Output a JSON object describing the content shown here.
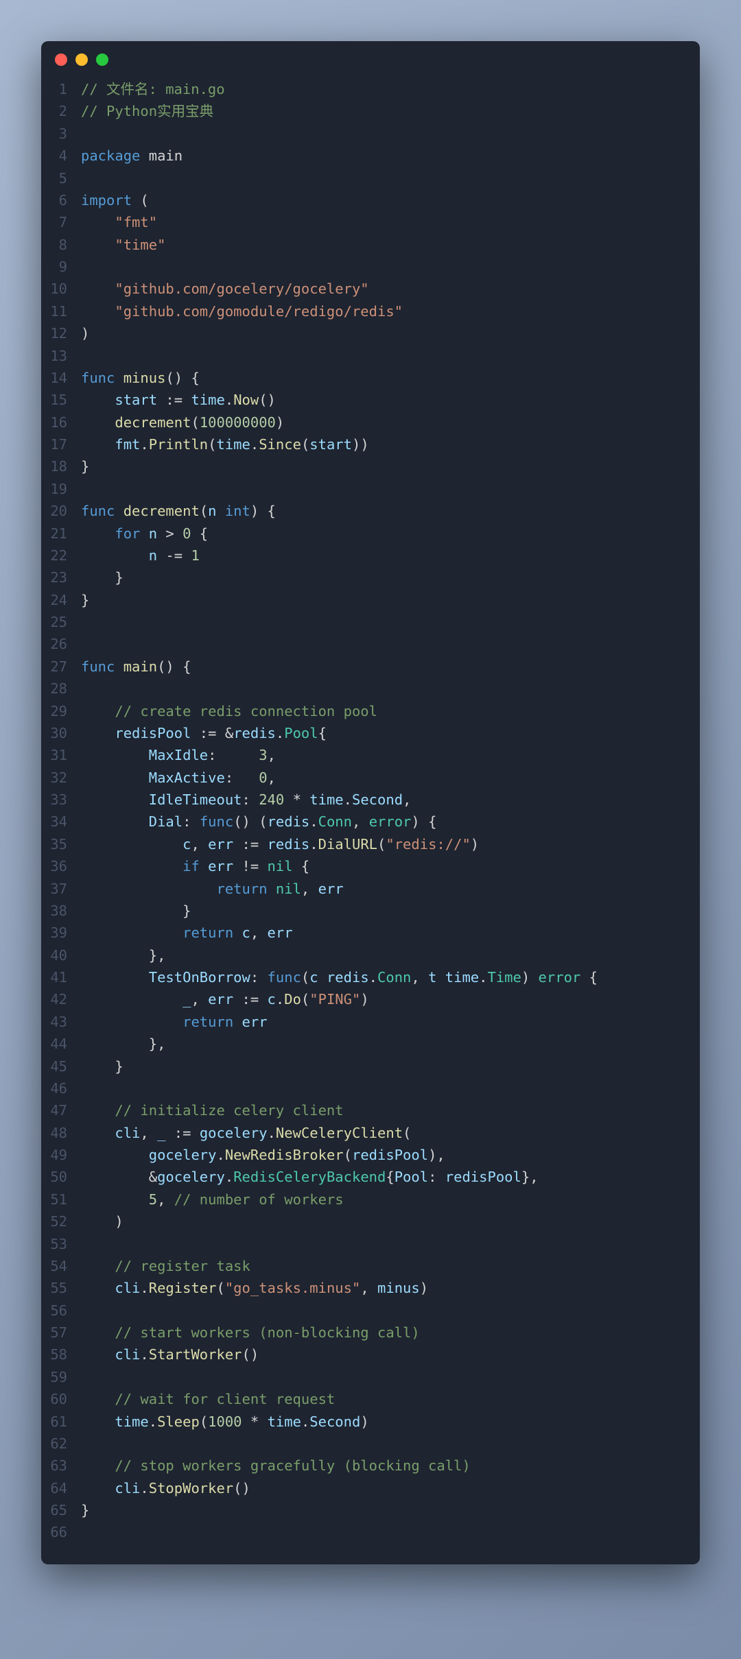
{
  "lines": [
    {
      "n": "1",
      "t": [
        [
          "comment",
          "// 文件名: main.go"
        ]
      ]
    },
    {
      "n": "2",
      "t": [
        [
          "comment",
          "// Python实用宝典"
        ]
      ]
    },
    {
      "n": "3",
      "t": []
    },
    {
      "n": "4",
      "t": [
        [
          "keyword",
          "package"
        ],
        [
          "pkg",
          " main"
        ]
      ]
    },
    {
      "n": "5",
      "t": []
    },
    {
      "n": "6",
      "t": [
        [
          "keyword",
          "import"
        ],
        [
          "paren",
          " ("
        ]
      ]
    },
    {
      "n": "7",
      "t": [
        [
          "pkg",
          "    "
        ],
        [
          "string",
          "\"fmt\""
        ]
      ]
    },
    {
      "n": "8",
      "t": [
        [
          "pkg",
          "    "
        ],
        [
          "string",
          "\"time\""
        ]
      ]
    },
    {
      "n": "9",
      "t": []
    },
    {
      "n": "10",
      "t": [
        [
          "pkg",
          "    "
        ],
        [
          "string",
          "\"github.com/gocelery/gocelery\""
        ]
      ]
    },
    {
      "n": "11",
      "t": [
        [
          "pkg",
          "    "
        ],
        [
          "string",
          "\"github.com/gomodule/redigo/redis\""
        ]
      ]
    },
    {
      "n": "12",
      "t": [
        [
          "paren",
          ")"
        ]
      ]
    },
    {
      "n": "13",
      "t": []
    },
    {
      "n": "14",
      "t": [
        [
          "keyword",
          "func"
        ],
        [
          "pkg",
          " "
        ],
        [
          "func-name",
          "minus"
        ],
        [
          "paren",
          "() {"
        ]
      ]
    },
    {
      "n": "15",
      "t": [
        [
          "pkg",
          "    "
        ],
        [
          "ident",
          "start"
        ],
        [
          "op",
          " := "
        ],
        [
          "ident",
          "time"
        ],
        [
          "op",
          "."
        ],
        [
          "func-name",
          "Now"
        ],
        [
          "paren",
          "()"
        ]
      ]
    },
    {
      "n": "16",
      "t": [
        [
          "pkg",
          "    "
        ],
        [
          "func-name",
          "decrement"
        ],
        [
          "paren",
          "("
        ],
        [
          "num",
          "100000000"
        ],
        [
          "paren",
          ")"
        ]
      ]
    },
    {
      "n": "17",
      "t": [
        [
          "pkg",
          "    "
        ],
        [
          "ident",
          "fmt"
        ],
        [
          "op",
          "."
        ],
        [
          "func-name",
          "Println"
        ],
        [
          "paren",
          "("
        ],
        [
          "ident",
          "time"
        ],
        [
          "op",
          "."
        ],
        [
          "func-name",
          "Since"
        ],
        [
          "paren",
          "("
        ],
        [
          "ident",
          "start"
        ],
        [
          "paren",
          "))"
        ]
      ]
    },
    {
      "n": "18",
      "t": [
        [
          "paren",
          "}"
        ]
      ]
    },
    {
      "n": "19",
      "t": []
    },
    {
      "n": "20",
      "t": [
        [
          "keyword",
          "func"
        ],
        [
          "pkg",
          " "
        ],
        [
          "func-name",
          "decrement"
        ],
        [
          "paren",
          "("
        ],
        [
          "ident",
          "n"
        ],
        [
          "pkg",
          " "
        ],
        [
          "keyword",
          "int"
        ],
        [
          "paren",
          ") {"
        ]
      ]
    },
    {
      "n": "21",
      "t": [
        [
          "pkg",
          "    "
        ],
        [
          "keyword",
          "for"
        ],
        [
          "pkg",
          " "
        ],
        [
          "ident",
          "n"
        ],
        [
          "op",
          " > "
        ],
        [
          "num",
          "0"
        ],
        [
          "paren",
          " {"
        ]
      ]
    },
    {
      "n": "22",
      "t": [
        [
          "pkg",
          "        "
        ],
        [
          "ident",
          "n"
        ],
        [
          "op",
          " -= "
        ],
        [
          "num",
          "1"
        ]
      ]
    },
    {
      "n": "23",
      "t": [
        [
          "pkg",
          "    "
        ],
        [
          "paren",
          "}"
        ]
      ]
    },
    {
      "n": "24",
      "t": [
        [
          "paren",
          "}"
        ]
      ]
    },
    {
      "n": "25",
      "t": []
    },
    {
      "n": "26",
      "t": []
    },
    {
      "n": "27",
      "t": [
        [
          "keyword",
          "func"
        ],
        [
          "pkg",
          " "
        ],
        [
          "func-name",
          "main"
        ],
        [
          "paren",
          "() {"
        ]
      ]
    },
    {
      "n": "28",
      "t": []
    },
    {
      "n": "29",
      "t": [
        [
          "pkg",
          "    "
        ],
        [
          "comment",
          "// create redis connection pool"
        ]
      ]
    },
    {
      "n": "30",
      "t": [
        [
          "pkg",
          "    "
        ],
        [
          "ident",
          "redisPool"
        ],
        [
          "op",
          " := &"
        ],
        [
          "ident",
          "redis"
        ],
        [
          "op",
          "."
        ],
        [
          "type",
          "Pool"
        ],
        [
          "paren",
          "{"
        ]
      ]
    },
    {
      "n": "31",
      "t": [
        [
          "pkg",
          "        "
        ],
        [
          "ident",
          "MaxIdle"
        ],
        [
          "op",
          ":     "
        ],
        [
          "num",
          "3"
        ],
        [
          "op",
          ","
        ]
      ]
    },
    {
      "n": "32",
      "t": [
        [
          "pkg",
          "        "
        ],
        [
          "ident",
          "MaxActive"
        ],
        [
          "op",
          ":   "
        ],
        [
          "num",
          "0"
        ],
        [
          "op",
          ","
        ]
      ]
    },
    {
      "n": "33",
      "t": [
        [
          "pkg",
          "        "
        ],
        [
          "ident",
          "IdleTimeout"
        ],
        [
          "op",
          ": "
        ],
        [
          "num",
          "240"
        ],
        [
          "op",
          " * "
        ],
        [
          "ident",
          "time"
        ],
        [
          "op",
          "."
        ],
        [
          "ident",
          "Second"
        ],
        [
          "op",
          ","
        ]
      ]
    },
    {
      "n": "34",
      "t": [
        [
          "pkg",
          "        "
        ],
        [
          "ident",
          "Dial"
        ],
        [
          "op",
          ": "
        ],
        [
          "keyword",
          "func"
        ],
        [
          "paren",
          "() ("
        ],
        [
          "ident",
          "redis"
        ],
        [
          "op",
          "."
        ],
        [
          "type",
          "Conn"
        ],
        [
          "op",
          ", "
        ],
        [
          "type",
          "error"
        ],
        [
          "paren",
          ") {"
        ]
      ]
    },
    {
      "n": "35",
      "t": [
        [
          "pkg",
          "            "
        ],
        [
          "ident",
          "c"
        ],
        [
          "op",
          ", "
        ],
        [
          "ident",
          "err"
        ],
        [
          "op",
          " := "
        ],
        [
          "ident",
          "redis"
        ],
        [
          "op",
          "."
        ],
        [
          "func-name",
          "DialURL"
        ],
        [
          "paren",
          "("
        ],
        [
          "string",
          "\"redis://\""
        ],
        [
          "paren",
          ")"
        ]
      ]
    },
    {
      "n": "36",
      "t": [
        [
          "pkg",
          "            "
        ],
        [
          "keyword",
          "if"
        ],
        [
          "pkg",
          " "
        ],
        [
          "ident",
          "err"
        ],
        [
          "op",
          " != "
        ],
        [
          "const",
          "nil"
        ],
        [
          "paren",
          " {"
        ]
      ]
    },
    {
      "n": "37",
      "t": [
        [
          "pkg",
          "                "
        ],
        [
          "keyword",
          "return"
        ],
        [
          "pkg",
          " "
        ],
        [
          "const",
          "nil"
        ],
        [
          "op",
          ", "
        ],
        [
          "ident",
          "err"
        ]
      ]
    },
    {
      "n": "38",
      "t": [
        [
          "pkg",
          "            "
        ],
        [
          "paren",
          "}"
        ]
      ]
    },
    {
      "n": "39",
      "t": [
        [
          "pkg",
          "            "
        ],
        [
          "keyword",
          "return"
        ],
        [
          "pkg",
          " "
        ],
        [
          "ident",
          "c"
        ],
        [
          "op",
          ", "
        ],
        [
          "ident",
          "err"
        ]
      ]
    },
    {
      "n": "40",
      "t": [
        [
          "pkg",
          "        "
        ],
        [
          "paren",
          "},"
        ]
      ]
    },
    {
      "n": "41",
      "t": [
        [
          "pkg",
          "        "
        ],
        [
          "ident",
          "TestOnBorrow"
        ],
        [
          "op",
          ": "
        ],
        [
          "keyword",
          "func"
        ],
        [
          "paren",
          "("
        ],
        [
          "ident",
          "c"
        ],
        [
          "pkg",
          " "
        ],
        [
          "ident",
          "redis"
        ],
        [
          "op",
          "."
        ],
        [
          "type",
          "Conn"
        ],
        [
          "op",
          ", "
        ],
        [
          "ident",
          "t"
        ],
        [
          "pkg",
          " "
        ],
        [
          "ident",
          "time"
        ],
        [
          "op",
          "."
        ],
        [
          "type",
          "Time"
        ],
        [
          "paren",
          ") "
        ],
        [
          "type",
          "error"
        ],
        [
          "paren",
          " {"
        ]
      ]
    },
    {
      "n": "42",
      "t": [
        [
          "pkg",
          "            "
        ],
        [
          "ident",
          "_"
        ],
        [
          "op",
          ", "
        ],
        [
          "ident",
          "err"
        ],
        [
          "op",
          " := "
        ],
        [
          "ident",
          "c"
        ],
        [
          "op",
          "."
        ],
        [
          "func-name",
          "Do"
        ],
        [
          "paren",
          "("
        ],
        [
          "string",
          "\"PING\""
        ],
        [
          "paren",
          ")"
        ]
      ]
    },
    {
      "n": "43",
      "t": [
        [
          "pkg",
          "            "
        ],
        [
          "keyword",
          "return"
        ],
        [
          "pkg",
          " "
        ],
        [
          "ident",
          "err"
        ]
      ]
    },
    {
      "n": "44",
      "t": [
        [
          "pkg",
          "        "
        ],
        [
          "paren",
          "},"
        ]
      ]
    },
    {
      "n": "45",
      "t": [
        [
          "pkg",
          "    "
        ],
        [
          "paren",
          "}"
        ]
      ]
    },
    {
      "n": "46",
      "t": []
    },
    {
      "n": "47",
      "t": [
        [
          "pkg",
          "    "
        ],
        [
          "comment",
          "// initialize celery client"
        ]
      ]
    },
    {
      "n": "48",
      "t": [
        [
          "pkg",
          "    "
        ],
        [
          "ident",
          "cli"
        ],
        [
          "op",
          ", "
        ],
        [
          "ident",
          "_"
        ],
        [
          "op",
          " := "
        ],
        [
          "ident",
          "gocelery"
        ],
        [
          "op",
          "."
        ],
        [
          "func-name",
          "NewCeleryClient"
        ],
        [
          "paren",
          "("
        ]
      ]
    },
    {
      "n": "49",
      "t": [
        [
          "pkg",
          "        "
        ],
        [
          "ident",
          "gocelery"
        ],
        [
          "op",
          "."
        ],
        [
          "func-name",
          "NewRedisBroker"
        ],
        [
          "paren",
          "("
        ],
        [
          "ident",
          "redisPool"
        ],
        [
          "paren",
          "),"
        ]
      ]
    },
    {
      "n": "50",
      "t": [
        [
          "pkg",
          "        "
        ],
        [
          "op",
          "&"
        ],
        [
          "ident",
          "gocelery"
        ],
        [
          "op",
          "."
        ],
        [
          "type",
          "RedisCeleryBackend"
        ],
        [
          "paren",
          "{"
        ],
        [
          "ident",
          "Pool"
        ],
        [
          "op",
          ": "
        ],
        [
          "ident",
          "redisPool"
        ],
        [
          "paren",
          "},"
        ]
      ]
    },
    {
      "n": "51",
      "t": [
        [
          "pkg",
          "        "
        ],
        [
          "num",
          "5"
        ],
        [
          "op",
          ", "
        ],
        [
          "comment",
          "// number of workers"
        ]
      ]
    },
    {
      "n": "52",
      "t": [
        [
          "pkg",
          "    "
        ],
        [
          "paren",
          ")"
        ]
      ]
    },
    {
      "n": "53",
      "t": []
    },
    {
      "n": "54",
      "t": [
        [
          "pkg",
          "    "
        ],
        [
          "comment",
          "// register task"
        ]
      ]
    },
    {
      "n": "55",
      "t": [
        [
          "pkg",
          "    "
        ],
        [
          "ident",
          "cli"
        ],
        [
          "op",
          "."
        ],
        [
          "func-name",
          "Register"
        ],
        [
          "paren",
          "("
        ],
        [
          "string",
          "\"go_tasks.minus\""
        ],
        [
          "op",
          ", "
        ],
        [
          "ident",
          "minus"
        ],
        [
          "paren",
          ")"
        ]
      ]
    },
    {
      "n": "56",
      "t": []
    },
    {
      "n": "57",
      "t": [
        [
          "pkg",
          "    "
        ],
        [
          "comment",
          "// start workers (non-blocking call)"
        ]
      ]
    },
    {
      "n": "58",
      "t": [
        [
          "pkg",
          "    "
        ],
        [
          "ident",
          "cli"
        ],
        [
          "op",
          "."
        ],
        [
          "func-name",
          "StartWorker"
        ],
        [
          "paren",
          "()"
        ]
      ]
    },
    {
      "n": "59",
      "t": []
    },
    {
      "n": "60",
      "t": [
        [
          "pkg",
          "    "
        ],
        [
          "comment",
          "// wait for client request"
        ]
      ]
    },
    {
      "n": "61",
      "t": [
        [
          "pkg",
          "    "
        ],
        [
          "ident",
          "time"
        ],
        [
          "op",
          "."
        ],
        [
          "func-name",
          "Sleep"
        ],
        [
          "paren",
          "("
        ],
        [
          "num",
          "1000"
        ],
        [
          "op",
          " * "
        ],
        [
          "ident",
          "time"
        ],
        [
          "op",
          "."
        ],
        [
          "ident",
          "Second"
        ],
        [
          "paren",
          ")"
        ]
      ]
    },
    {
      "n": "62",
      "t": []
    },
    {
      "n": "63",
      "t": [
        [
          "pkg",
          "    "
        ],
        [
          "comment",
          "// stop workers gracefully (blocking call)"
        ]
      ]
    },
    {
      "n": "64",
      "t": [
        [
          "pkg",
          "    "
        ],
        [
          "ident",
          "cli"
        ],
        [
          "op",
          "."
        ],
        [
          "func-name",
          "StopWorker"
        ],
        [
          "paren",
          "()"
        ]
      ]
    },
    {
      "n": "65",
      "t": [
        [
          "paren",
          "}"
        ]
      ]
    },
    {
      "n": "66",
      "t": []
    }
  ]
}
